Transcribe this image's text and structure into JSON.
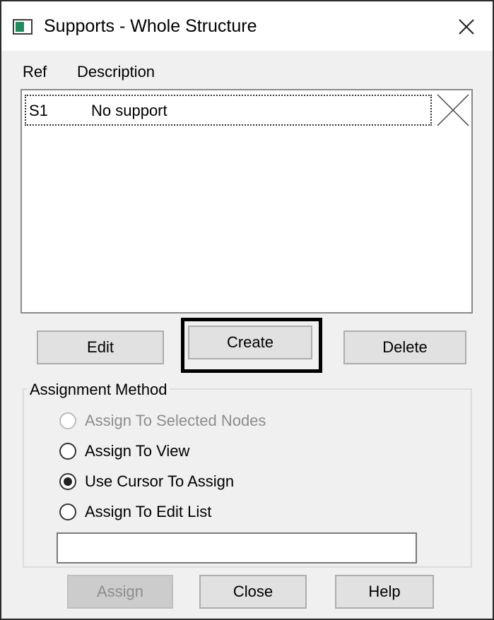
{
  "window": {
    "title": "Supports - Whole Structure"
  },
  "list": {
    "columns": {
      "ref": "Ref",
      "description": "Description"
    },
    "rows": [
      {
        "ref": "S1",
        "description": "No support"
      }
    ]
  },
  "buttons": {
    "edit": "Edit",
    "create": "Create",
    "delete": "Delete",
    "assign": "Assign",
    "close": "Close",
    "help": "Help"
  },
  "assignment": {
    "label": "Assignment Method",
    "options": [
      {
        "label": "Assign To Selected Nodes",
        "enabled": false,
        "checked": false
      },
      {
        "label": "Assign To View",
        "enabled": true,
        "checked": false
      },
      {
        "label": "Use Cursor To Assign",
        "enabled": true,
        "checked": true
      },
      {
        "label": "Assign To Edit List",
        "enabled": true,
        "checked": false
      }
    ],
    "edit_list_value": ""
  },
  "colors": {
    "dialog_bg": "#f0f0f0",
    "titlebar_bg": "#ffffff",
    "button_bg": "#e1e1e1",
    "disabled_text": "#8d8d8d",
    "app_icon_accent": "#1e8c5a"
  },
  "icons": {
    "app": "app-window-icon",
    "close": "close-icon",
    "row_status": "cross-icon"
  }
}
